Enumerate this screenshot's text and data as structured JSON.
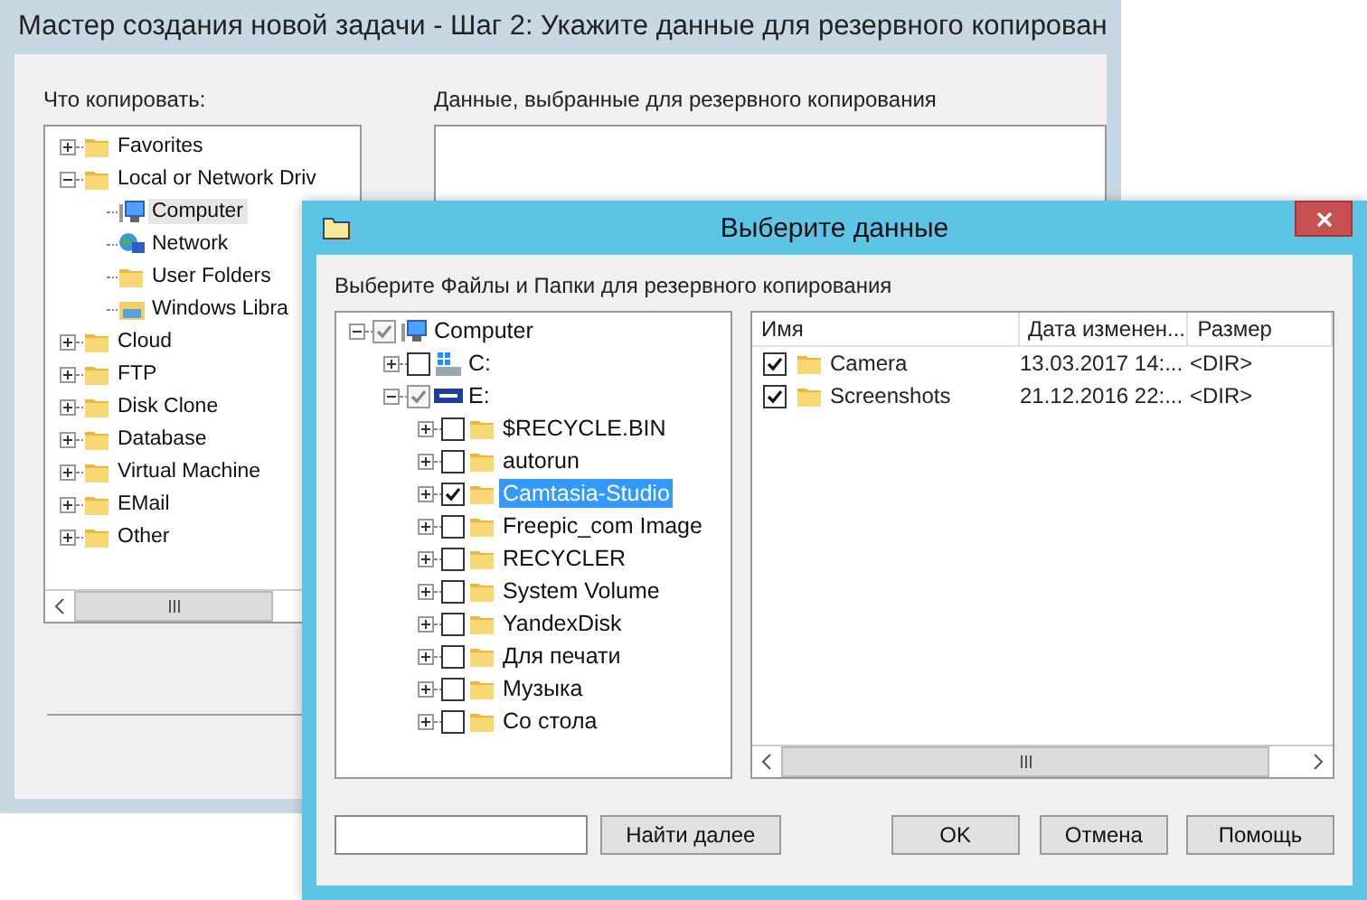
{
  "background_window": {
    "title": "Мастер создания новой задачи - Шаг 2: Укажите данные для резервного копирован",
    "source_label": "Что копировать:",
    "source_tree": [
      {
        "label": "Favorites",
        "kind": "folder",
        "has_expander": true,
        "expanded": false,
        "selected": false
      },
      {
        "label": "Local or Network Driv",
        "kind": "folder",
        "has_expander": true,
        "expanded": true,
        "selected": false,
        "children": [
          {
            "label": "Computer",
            "kind": "computer",
            "has_expander": false,
            "selected": true
          },
          {
            "label": "Network",
            "kind": "network",
            "has_expander": false,
            "selected": false
          },
          {
            "label": "User Folders",
            "kind": "folder",
            "has_expander": false,
            "selected": false
          },
          {
            "label": "Windows Libra",
            "kind": "library",
            "has_expander": false,
            "selected": false
          }
        ]
      },
      {
        "label": "Cloud",
        "kind": "folder",
        "has_expander": true,
        "expanded": false,
        "selected": false
      },
      {
        "label": "FTP",
        "kind": "folder",
        "has_expander": true,
        "expanded": false,
        "selected": false
      },
      {
        "label": "Disk Clone",
        "kind": "folder",
        "has_expander": true,
        "expanded": false,
        "selected": false
      },
      {
        "label": "Database",
        "kind": "folder",
        "has_expander": true,
        "expanded": false,
        "selected": false
      },
      {
        "label": "Virtual Machine",
        "kind": "folder",
        "has_expander": true,
        "expanded": false,
        "selected": false
      },
      {
        "label": "EMail",
        "kind": "folder",
        "has_expander": true,
        "expanded": false,
        "selected": false
      },
      {
        "label": "Other",
        "kind": "folder",
        "has_expander": true,
        "expanded": false,
        "selected": false
      }
    ],
    "selection_label": "Данные, выбранные для резервного копирования"
  },
  "dialog": {
    "title": "Выберите данные",
    "instruction": "Выберите Файлы и Папки для резервного копирования",
    "tree": [
      {
        "label": "Computer",
        "kind": "computer",
        "has_expander": true,
        "expanded": true,
        "selected": false,
        "checked": true,
        "partial": true,
        "children": [
          {
            "label": "C:",
            "kind": "drive",
            "has_expander": true,
            "expanded": false,
            "selected": false,
            "checked": false,
            "partial": false
          },
          {
            "label": "E:",
            "kind": "wd-drive",
            "has_expander": true,
            "expanded": true,
            "selected": false,
            "checked": true,
            "partial": true,
            "children": [
              {
                "label": "$RECYCLE.BIN",
                "kind": "folder",
                "has_expander": true,
                "expanded": false,
                "selected": false,
                "checked": false,
                "partial": false
              },
              {
                "label": "autorun",
                "kind": "folder",
                "has_expander": true,
                "expanded": false,
                "selected": false,
                "checked": false,
                "partial": false
              },
              {
                "label": "Camtasia-Studio",
                "kind": "folder",
                "has_expander": true,
                "expanded": false,
                "selected": true,
                "checked": true,
                "partial": false
              },
              {
                "label": "Freepic_com Image",
                "kind": "folder",
                "has_expander": true,
                "expanded": false,
                "selected": false,
                "checked": false,
                "partial": false
              },
              {
                "label": "RECYCLER",
                "kind": "folder",
                "has_expander": true,
                "expanded": false,
                "selected": false,
                "checked": false,
                "partial": false
              },
              {
                "label": "System Volume",
                "kind": "folder",
                "has_expander": true,
                "expanded": false,
                "selected": false,
                "checked": false,
                "partial": false
              },
              {
                "label": "YandexDisk",
                "kind": "folder",
                "has_expander": true,
                "expanded": false,
                "selected": false,
                "checked": false,
                "partial": false
              },
              {
                "label": "Для печати",
                "kind": "folder",
                "has_expander": true,
                "expanded": false,
                "selected": false,
                "checked": false,
                "partial": false
              },
              {
                "label": "Музыка",
                "kind": "folder",
                "has_expander": true,
                "expanded": false,
                "selected": false,
                "checked": false,
                "partial": false
              },
              {
                "label": "Со стола",
                "kind": "folder",
                "has_expander": true,
                "expanded": false,
                "selected": false,
                "checked": false,
                "partial": false
              }
            ]
          }
        ]
      }
    ],
    "list": {
      "columns": [
        "Имя",
        "Дата изменен...",
        "Размер"
      ],
      "rows": [
        {
          "checked": true,
          "name": "Camera",
          "modified": "13.03.2017 14:...",
          "size": "<DIR>"
        },
        {
          "checked": true,
          "name": "Screenshots",
          "modified": "21.12.2016 22:...",
          "size": "<DIR>"
        }
      ]
    },
    "find_button": "Найти далее",
    "buttons": [
      "OK",
      "Отмена",
      "Помощь"
    ]
  }
}
